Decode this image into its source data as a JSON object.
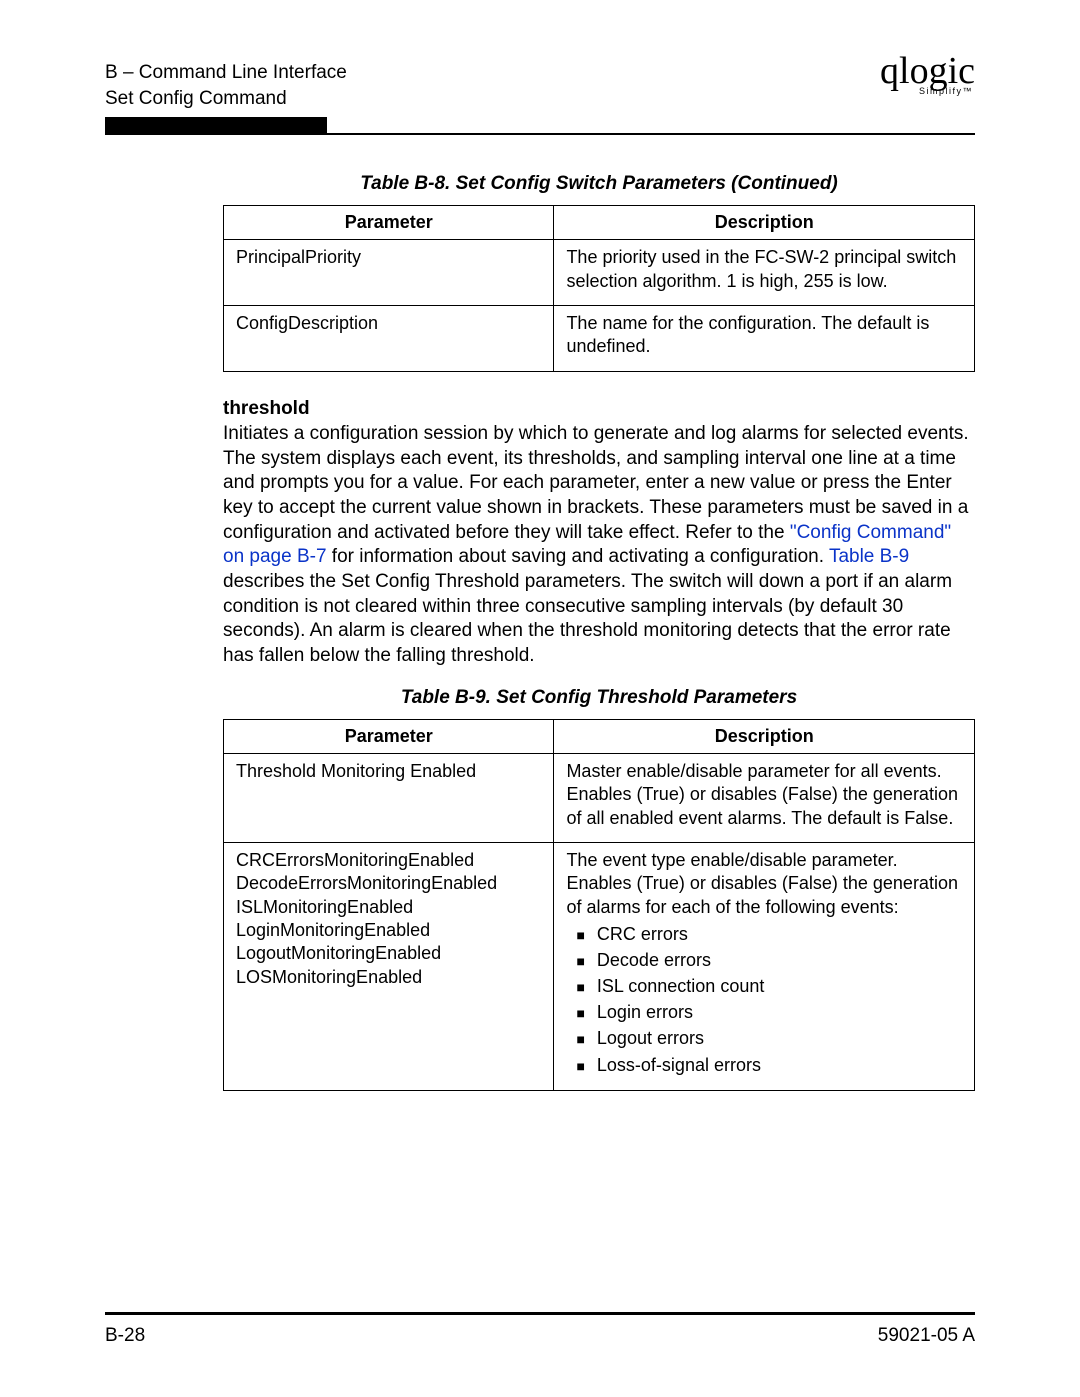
{
  "header": {
    "line1": "B – Command Line Interface",
    "line2": "Set Config Command",
    "logo_main": "qlogic",
    "logo_sub": "Simplify™"
  },
  "table8": {
    "caption": "Table B-8. Set Config Switch Parameters (Continued)",
    "head_param": "Parameter",
    "head_desc": "Description",
    "rows": [
      {
        "param": "PrincipalPriority",
        "desc": "The priority used in the FC-SW-2 principal switch selection algorithm. 1 is high, 255 is low."
      },
      {
        "param": "ConfigDescription",
        "desc": "The name for the configuration. The default is undefined."
      }
    ]
  },
  "threshold": {
    "heading": "threshold",
    "text_before_link1": "Initiates a configuration session by which to generate and log alarms for selected events. The system displays each event, its thresholds, and sampling interval one line at a time and prompts you for a value. For each parameter, enter a new value or press the Enter key to accept the current value shown in brackets. These parameters must be saved in a configuration and activated before they will take effect. Refer to the ",
    "link1": "\"Config Command\" on page B-7",
    "text_between": " for information about saving and activating a configuration. ",
    "link2": "Table B-9",
    "text_after_link2": " describes the Set Config Threshold parameters. The switch will down a port if an alarm condition is not cleared within three consecutive sampling intervals (by default 30 seconds). An alarm is cleared when the threshold monitoring detects that the error rate has fallen below the falling threshold."
  },
  "table9": {
    "caption": "Table B-9. Set Config Threshold Parameters",
    "head_param": "Parameter",
    "head_desc": "Description",
    "rows": [
      {
        "param_lines": [
          "Threshold Monitoring Enabled"
        ],
        "desc_text": "Master enable/disable parameter for all events. Enables (True) or disables (False) the generation of all enabled event alarms. The default is False.",
        "bullets": []
      },
      {
        "param_lines": [
          "CRCErrorsMonitoringEnabled",
          "DecodeErrorsMonitoringEnabled",
          "ISLMonitoringEnabled",
          "LoginMonitoringEnabled",
          "LogoutMonitoringEnabled",
          "LOSMonitoringEnabled"
        ],
        "desc_text": "The event type enable/disable parameter. Enables (True) or disables (False) the generation of alarms for each of the following events:",
        "bullets": [
          "CRC errors",
          "Decode errors",
          "ISL connection count",
          "Login errors",
          "Logout errors",
          "Loss-of-signal errors"
        ]
      }
    ]
  },
  "footer": {
    "left": "B-28",
    "right": "59021-05  A"
  }
}
